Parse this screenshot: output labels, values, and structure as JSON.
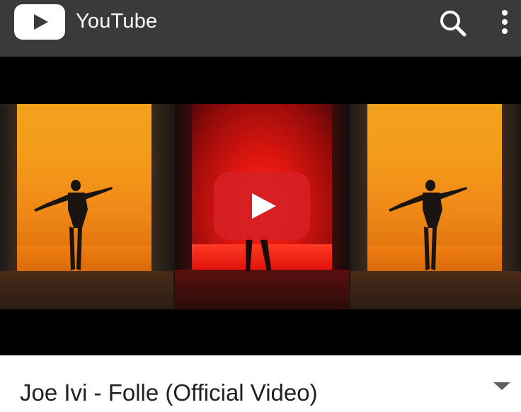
{
  "app": {
    "title": "YouTube"
  },
  "icons": {
    "logo": "youtube-logo-icon",
    "search": "search-icon",
    "menu": "more-vert-icon",
    "play": "play-icon",
    "expand": "chevron-down-icon"
  },
  "video": {
    "title": "Joe Ivi - Folle (Official Video)"
  },
  "colors": {
    "app_bar": "#3a3a3a",
    "play_overlay": "#d62024",
    "title_text": "#212121"
  }
}
